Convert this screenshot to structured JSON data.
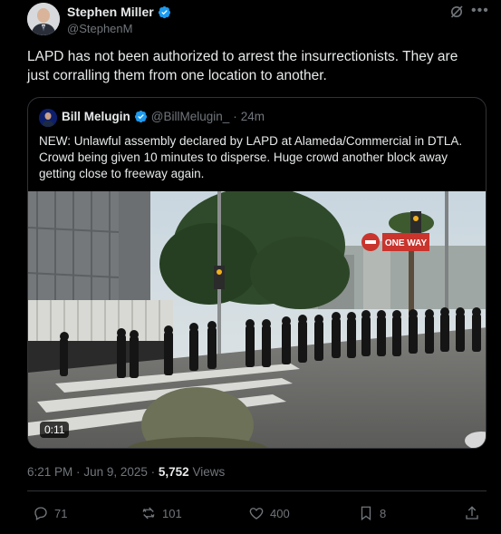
{
  "author": {
    "display_name": "Stephen Miller",
    "handle": "@StephenM",
    "verified": true
  },
  "tweet": {
    "text": "LAPD has not been authorized to arrest the insurrectionists. They are just corralling them from one location to another."
  },
  "quote": {
    "display_name": "Bill Melugin",
    "handle": "@BillMelugin_",
    "separator": "·",
    "time_ago": "24m",
    "verified": true,
    "text": "NEW: Unlawful assembly declared by LAPD at Alameda/Commercial in DTLA. Crowd being given 10 minutes to disperse. Huge crowd another block away getting close to freeway again.",
    "video_duration": "0:11",
    "sign_text": "ONE WAY"
  },
  "meta": {
    "time": "6:21 PM",
    "sep": "·",
    "date": "Jun 9, 2025",
    "sep2": "·",
    "views_count": "5,752",
    "views_label": "Views"
  },
  "actions": {
    "reply_count": "71",
    "retweet_count": "101",
    "like_count": "400",
    "bookmark_count": "8"
  },
  "colors": {
    "background": "#000000",
    "text": "#e7e9ea",
    "muted": "#71767b",
    "verified_blue": "#1d9bf0",
    "border": "#2f3336"
  }
}
